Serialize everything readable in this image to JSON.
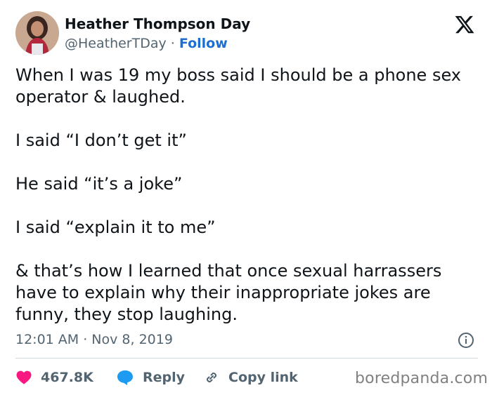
{
  "author": {
    "display_name": "Heather Thompson Day",
    "handle": "@HeatherTDay",
    "separator": " · ",
    "follow_label": "Follow",
    "avatar": "avatar-photo"
  },
  "platform": {
    "logo_icon": "x-logo-icon"
  },
  "tweet": {
    "paragraphs": [
      "When I was 19 my boss said I should be a phone sex operator & laughed.",
      "I said “I don’t get it”",
      "He said “it’s a joke”",
      "I said “explain it to me”",
      "& that’s how I learned that once sexual harrassers have to explain why their inappropriate jokes are funny, they stop laughing."
    ],
    "timestamp": "12:01 AM · Nov 8, 2019"
  },
  "actions": {
    "likes": "467.8K",
    "reply_label": "Reply",
    "copy_link_label": "Copy link"
  },
  "watermark": "boredpanda.com",
  "colors": {
    "like": "#f91880",
    "reply": "#1d9bf0",
    "follow": "#1d6fcf",
    "muted": "#536471"
  }
}
